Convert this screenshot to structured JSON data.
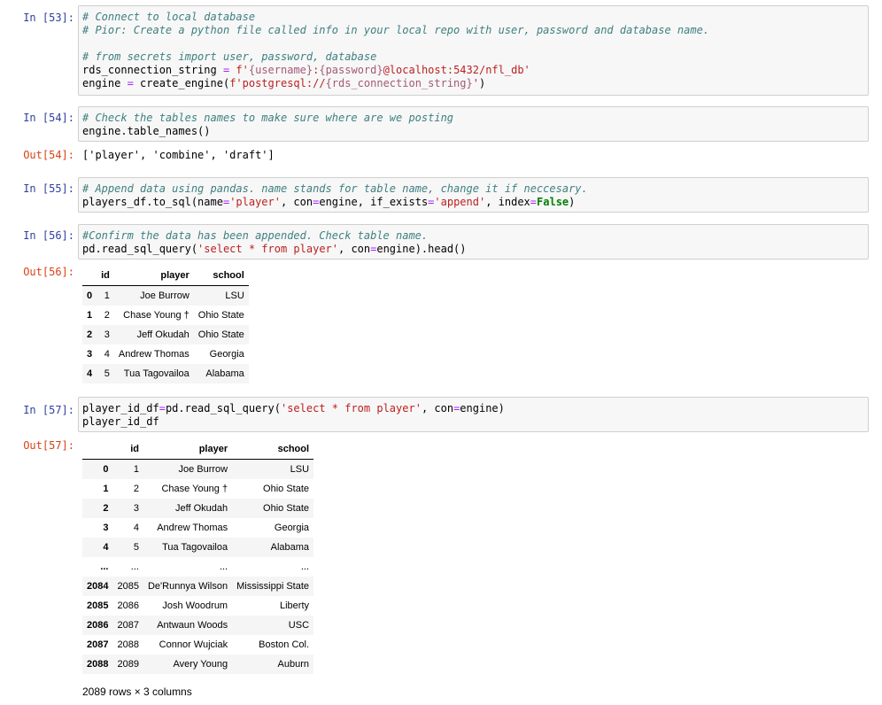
{
  "cells": [
    {
      "in_prompt": "In [53]:",
      "lines": [
        "# Connect to local database",
        "# Pior: Create a python file called info in your local repo with user, password and database name.",
        "",
        "# from secrets import user, password, database",
        "rds_connection_string = f'{username}:{password}@localhost:5432/nfl_db'",
        "engine = create_engine(f'postgresql://{rds_connection_string}')"
      ]
    },
    {
      "in_prompt": "In [54]:",
      "lines": [
        "# Check the tables names to make sure where are we posting",
        "engine.table_names()"
      ],
      "out_prompt": "Out[54]:",
      "out_text": "['player', 'combine', 'draft']"
    },
    {
      "in_prompt": "In [55]:",
      "lines": [
        "# Append data using pandas. name stands for table name, change it if neccesary.",
        "players_df.to_sql(name='player', con=engine, if_exists='append', index=False)"
      ]
    },
    {
      "in_prompt": "In [56]:",
      "lines": [
        "#Confirm the data has been appended. Check table name.",
        "pd.read_sql_query('select * from player', con=engine).head()"
      ],
      "out_prompt": "Out[56]:"
    },
    {
      "in_prompt": "In [57]:",
      "lines": [
        "player_id_df=pd.read_sql_query('select * from player', con=engine)",
        "player_id_df"
      ],
      "out_prompt": "Out[57]:"
    }
  ],
  "df_head": {
    "columns": [
      "",
      "id",
      "player",
      "school"
    ],
    "rows": [
      [
        "0",
        "1",
        "Joe Burrow",
        "LSU"
      ],
      [
        "1",
        "2",
        "Chase Young †",
        "Ohio State"
      ],
      [
        "2",
        "3",
        "Jeff Okudah",
        "Ohio State"
      ],
      [
        "3",
        "4",
        "Andrew Thomas",
        "Georgia"
      ],
      [
        "4",
        "5",
        "Tua Tagovailoa",
        "Alabama"
      ]
    ]
  },
  "df_full": {
    "columns": [
      "",
      "id",
      "player",
      "school"
    ],
    "rows": [
      [
        "0",
        "1",
        "Joe Burrow",
        "LSU"
      ],
      [
        "1",
        "2",
        "Chase Young †",
        "Ohio State"
      ],
      [
        "2",
        "3",
        "Jeff Okudah",
        "Ohio State"
      ],
      [
        "3",
        "4",
        "Andrew Thomas",
        "Georgia"
      ],
      [
        "4",
        "5",
        "Tua Tagovailoa",
        "Alabama"
      ],
      [
        "...",
        "...",
        "...",
        "..."
      ],
      [
        "2084",
        "2085",
        "De'Runnya Wilson",
        "Mississippi State"
      ],
      [
        "2085",
        "2086",
        "Josh Woodrum",
        "Liberty"
      ],
      [
        "2086",
        "2087",
        "Antwaun Woods",
        "USC"
      ],
      [
        "2087",
        "2088",
        "Connor Wujciak",
        "Boston Col."
      ],
      [
        "2088",
        "2089",
        "Avery Young",
        "Auburn"
      ]
    ],
    "footer": "2089 rows × 3 columns"
  }
}
